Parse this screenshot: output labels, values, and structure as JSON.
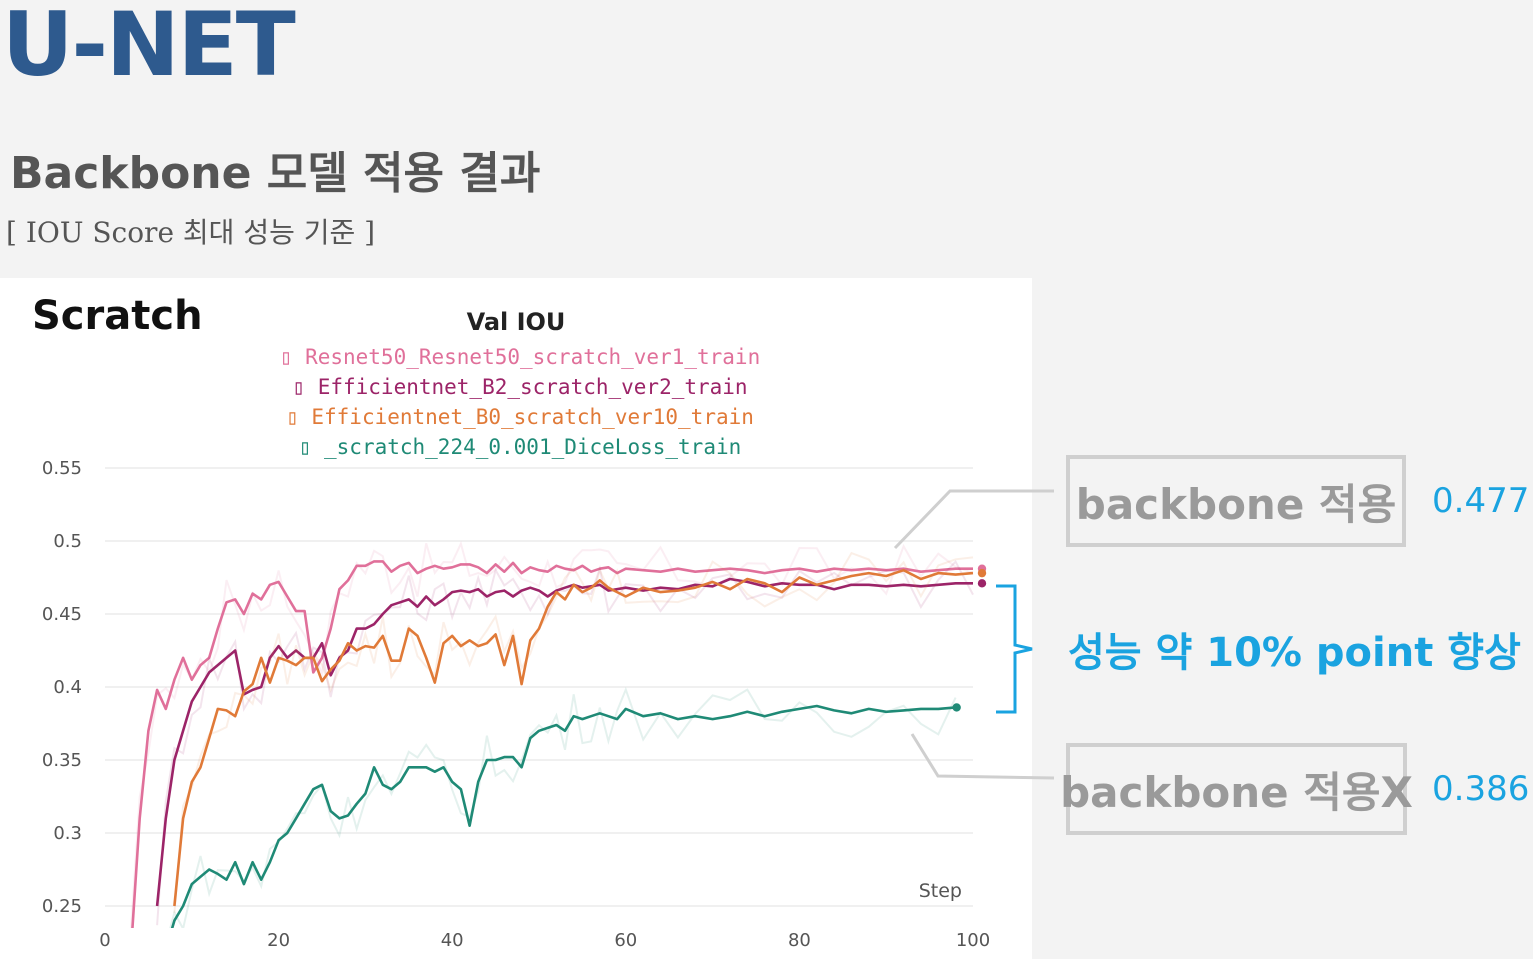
{
  "slide": {
    "title": "U-NET",
    "section_title": "Backbone 모델 적용 결과",
    "criteria": "[ IOU Score 최대 성능 기준 ]"
  },
  "panel": {
    "label": "Scratch"
  },
  "callouts": {
    "with_backbone": {
      "label": "backbone 적용",
      "value": "0.477"
    },
    "without_backbone": {
      "label": "backbone 적용X",
      "value": "0.386"
    },
    "improvement": "성능 약 10% point 향상",
    "colors": {
      "box_border": "#cfcfcf",
      "accent": "#1aa3e0"
    }
  },
  "chart_data": {
    "type": "line",
    "title": "Val IOU",
    "xlabel": "Step",
    "ylabel": "",
    "xlim": [
      0,
      100
    ],
    "ylim": [
      0.25,
      0.55
    ],
    "x_ticks": [
      "0",
      "20",
      "40",
      "60",
      "80",
      "100"
    ],
    "y_ticks": [
      "0.55",
      "0.5",
      "0.45",
      "0.4",
      "0.35",
      "0.3",
      "0.25"
    ],
    "grid": true,
    "legend_position": "top-center",
    "series": [
      {
        "name": "Resnet50_Resnet50_scratch_ver1_train",
        "color": "#e0709a",
        "final": 0.481,
        "points": [
          [
            3,
            0.22
          ],
          [
            4,
            0.31
          ],
          [
            5,
            0.37
          ],
          [
            6,
            0.398
          ],
          [
            7,
            0.385
          ],
          [
            8,
            0.405
          ],
          [
            9,
            0.42
          ],
          [
            10,
            0.405
          ],
          [
            11,
            0.415
          ],
          [
            12,
            0.42
          ],
          [
            13,
            0.44
          ],
          [
            14,
            0.458
          ],
          [
            15,
            0.46
          ],
          [
            16,
            0.45
          ],
          [
            17,
            0.464
          ],
          [
            18,
            0.46
          ],
          [
            19,
            0.47
          ],
          [
            20,
            0.472
          ],
          [
            21,
            0.462
          ],
          [
            22,
            0.452
          ],
          [
            23,
            0.452
          ],
          [
            24,
            0.41
          ],
          [
            25,
            0.42
          ],
          [
            26,
            0.44
          ],
          [
            27,
            0.467
          ],
          [
            28,
            0.473
          ],
          [
            29,
            0.483
          ],
          [
            30,
            0.483
          ],
          [
            31,
            0.486
          ],
          [
            32,
            0.486
          ],
          [
            33,
            0.479
          ],
          [
            34,
            0.483
          ],
          [
            35,
            0.485
          ],
          [
            36,
            0.478
          ],
          [
            37,
            0.481
          ],
          [
            38,
            0.483
          ],
          [
            39,
            0.481
          ],
          [
            40,
            0.482
          ],
          [
            41,
            0.484
          ],
          [
            42,
            0.484
          ],
          [
            43,
            0.482
          ],
          [
            44,
            0.478
          ],
          [
            45,
            0.484
          ],
          [
            46,
            0.479
          ],
          [
            47,
            0.485
          ],
          [
            48,
            0.478
          ],
          [
            49,
            0.482
          ],
          [
            50,
            0.48
          ],
          [
            51,
            0.479
          ],
          [
            52,
            0.483
          ],
          [
            53,
            0.481
          ],
          [
            54,
            0.48
          ],
          [
            55,
            0.483
          ],
          [
            56,
            0.479
          ],
          [
            57,
            0.481
          ],
          [
            58,
            0.482
          ],
          [
            59,
            0.478
          ],
          [
            60,
            0.481
          ],
          [
            62,
            0.48
          ],
          [
            64,
            0.479
          ],
          [
            66,
            0.481
          ],
          [
            68,
            0.479
          ],
          [
            70,
            0.48
          ],
          [
            72,
            0.481
          ],
          [
            74,
            0.48
          ],
          [
            76,
            0.478
          ],
          [
            78,
            0.48
          ],
          [
            80,
            0.481
          ],
          [
            82,
            0.479
          ],
          [
            84,
            0.481
          ],
          [
            86,
            0.48
          ],
          [
            88,
            0.481
          ],
          [
            90,
            0.48
          ],
          [
            92,
            0.481
          ],
          [
            94,
            0.479
          ],
          [
            96,
            0.48
          ],
          [
            98,
            0.481
          ],
          [
            100,
            0.481
          ]
        ]
      },
      {
        "name": "Efficientnet_B2_scratch_ver2_train",
        "color": "#9c2468",
        "final": 0.471,
        "points": [
          [
            6,
            0.25
          ],
          [
            7,
            0.31
          ],
          [
            8,
            0.35
          ],
          [
            9,
            0.37
          ],
          [
            10,
            0.39
          ],
          [
            11,
            0.4
          ],
          [
            12,
            0.41
          ],
          [
            13,
            0.415
          ],
          [
            14,
            0.42
          ],
          [
            15,
            0.425
          ],
          [
            16,
            0.395
          ],
          [
            17,
            0.398
          ],
          [
            18,
            0.4
          ],
          [
            19,
            0.42
          ],
          [
            20,
            0.428
          ],
          [
            21,
            0.42
          ],
          [
            22,
            0.425
          ],
          [
            23,
            0.42
          ],
          [
            24,
            0.42
          ],
          [
            25,
            0.43
          ],
          [
            26,
            0.408
          ],
          [
            27,
            0.42
          ],
          [
            28,
            0.425
          ],
          [
            29,
            0.44
          ],
          [
            30,
            0.44
          ],
          [
            31,
            0.443
          ],
          [
            32,
            0.45
          ],
          [
            33,
            0.456
          ],
          [
            34,
            0.458
          ],
          [
            35,
            0.46
          ],
          [
            36,
            0.455
          ],
          [
            37,
            0.462
          ],
          [
            38,
            0.456
          ],
          [
            39,
            0.46
          ],
          [
            40,
            0.465
          ],
          [
            41,
            0.466
          ],
          [
            42,
            0.465
          ],
          [
            43,
            0.467
          ],
          [
            44,
            0.462
          ],
          [
            45,
            0.465
          ],
          [
            46,
            0.466
          ],
          [
            47,
            0.462
          ],
          [
            48,
            0.466
          ],
          [
            49,
            0.468
          ],
          [
            50,
            0.466
          ],
          [
            51,
            0.462
          ],
          [
            52,
            0.466
          ],
          [
            53,
            0.468
          ],
          [
            54,
            0.47
          ],
          [
            55,
            0.468
          ],
          [
            56,
            0.469
          ],
          [
            57,
            0.47
          ],
          [
            58,
            0.466
          ],
          [
            60,
            0.468
          ],
          [
            62,
            0.466
          ],
          [
            64,
            0.468
          ],
          [
            66,
            0.467
          ],
          [
            68,
            0.47
          ],
          [
            70,
            0.469
          ],
          [
            72,
            0.474
          ],
          [
            74,
            0.472
          ],
          [
            76,
            0.469
          ],
          [
            78,
            0.471
          ],
          [
            80,
            0.47
          ],
          [
            82,
            0.47
          ],
          [
            84,
            0.467
          ],
          [
            86,
            0.47
          ],
          [
            88,
            0.47
          ],
          [
            90,
            0.469
          ],
          [
            92,
            0.47
          ],
          [
            94,
            0.469
          ],
          [
            96,
            0.47
          ],
          [
            98,
            0.471
          ],
          [
            100,
            0.471
          ]
        ]
      },
      {
        "name": "Efficientnet_B0_scratch_ver10_train",
        "color": "#e07a38",
        "final": 0.478,
        "points": [
          [
            8,
            0.25
          ],
          [
            9,
            0.31
          ],
          [
            10,
            0.335
          ],
          [
            11,
            0.345
          ],
          [
            12,
            0.365
          ],
          [
            13,
            0.385
          ],
          [
            14,
            0.384
          ],
          [
            15,
            0.38
          ],
          [
            16,
            0.397
          ],
          [
            17,
            0.402
          ],
          [
            18,
            0.42
          ],
          [
            19,
            0.403
          ],
          [
            20,
            0.42
          ],
          [
            21,
            0.418
          ],
          [
            22,
            0.415
          ],
          [
            23,
            0.42
          ],
          [
            24,
            0.42
          ],
          [
            25,
            0.404
          ],
          [
            26,
            0.412
          ],
          [
            27,
            0.418
          ],
          [
            28,
            0.43
          ],
          [
            29,
            0.425
          ],
          [
            30,
            0.428
          ],
          [
            31,
            0.427
          ],
          [
            32,
            0.435
          ],
          [
            33,
            0.418
          ],
          [
            34,
            0.418
          ],
          [
            35,
            0.44
          ],
          [
            36,
            0.435
          ],
          [
            37,
            0.42
          ],
          [
            38,
            0.403
          ],
          [
            39,
            0.43
          ],
          [
            40,
            0.435
          ],
          [
            41,
            0.428
          ],
          [
            42,
            0.432
          ],
          [
            43,
            0.428
          ],
          [
            44,
            0.43
          ],
          [
            45,
            0.436
          ],
          [
            46,
            0.415
          ],
          [
            47,
            0.435
          ],
          [
            48,
            0.402
          ],
          [
            49,
            0.432
          ],
          [
            50,
            0.44
          ],
          [
            51,
            0.455
          ],
          [
            52,
            0.465
          ],
          [
            53,
            0.46
          ],
          [
            54,
            0.47
          ],
          [
            55,
            0.465
          ],
          [
            56,
            0.468
          ],
          [
            57,
            0.473
          ],
          [
            58,
            0.468
          ],
          [
            59,
            0.465
          ],
          [
            60,
            0.462
          ],
          [
            62,
            0.468
          ],
          [
            64,
            0.465
          ],
          [
            66,
            0.466
          ],
          [
            68,
            0.468
          ],
          [
            70,
            0.472
          ],
          [
            72,
            0.467
          ],
          [
            74,
            0.474
          ],
          [
            76,
            0.471
          ],
          [
            78,
            0.465
          ],
          [
            80,
            0.475
          ],
          [
            82,
            0.47
          ],
          [
            84,
            0.473
          ],
          [
            86,
            0.476
          ],
          [
            88,
            0.478
          ],
          [
            90,
            0.476
          ],
          [
            92,
            0.48
          ],
          [
            94,
            0.474
          ],
          [
            96,
            0.478
          ],
          [
            98,
            0.477
          ],
          [
            100,
            0.478
          ]
        ]
      },
      {
        "name": "_scratch_224_0.001_DiceLoss_train",
        "color": "#1f8a76",
        "final": 0.386,
        "points": [
          [
            7,
            0.22
          ],
          [
            8,
            0.24
          ],
          [
            9,
            0.25
          ],
          [
            10,
            0.265
          ],
          [
            11,
            0.27
          ],
          [
            12,
            0.275
          ],
          [
            13,
            0.272
          ],
          [
            14,
            0.268
          ],
          [
            15,
            0.28
          ],
          [
            16,
            0.265
          ],
          [
            17,
            0.28
          ],
          [
            18,
            0.268
          ],
          [
            19,
            0.28
          ],
          [
            20,
            0.295
          ],
          [
            21,
            0.3
          ],
          [
            22,
            0.31
          ],
          [
            23,
            0.32
          ],
          [
            24,
            0.33
          ],
          [
            25,
            0.333
          ],
          [
            26,
            0.315
          ],
          [
            27,
            0.31
          ],
          [
            28,
            0.312
          ],
          [
            29,
            0.32
          ],
          [
            30,
            0.327
          ],
          [
            31,
            0.345
          ],
          [
            32,
            0.333
          ],
          [
            33,
            0.33
          ],
          [
            34,
            0.335
          ],
          [
            35,
            0.345
          ],
          [
            36,
            0.345
          ],
          [
            37,
            0.345
          ],
          [
            38,
            0.342
          ],
          [
            39,
            0.345
          ],
          [
            40,
            0.335
          ],
          [
            41,
            0.33
          ],
          [
            42,
            0.305
          ],
          [
            43,
            0.335
          ],
          [
            44,
            0.35
          ],
          [
            45,
            0.35
          ],
          [
            46,
            0.352
          ],
          [
            47,
            0.352
          ],
          [
            48,
            0.345
          ],
          [
            49,
            0.365
          ],
          [
            50,
            0.37
          ],
          [
            51,
            0.372
          ],
          [
            52,
            0.374
          ],
          [
            53,
            0.37
          ],
          [
            54,
            0.38
          ],
          [
            55,
            0.378
          ],
          [
            56,
            0.38
          ],
          [
            57,
            0.382
          ],
          [
            58,
            0.38
          ],
          [
            59,
            0.378
          ],
          [
            60,
            0.385
          ],
          [
            62,
            0.38
          ],
          [
            64,
            0.382
          ],
          [
            66,
            0.378
          ],
          [
            68,
            0.38
          ],
          [
            70,
            0.378
          ],
          [
            72,
            0.38
          ],
          [
            74,
            0.383
          ],
          [
            76,
            0.38
          ],
          [
            78,
            0.383
          ],
          [
            80,
            0.385
          ],
          [
            82,
            0.387
          ],
          [
            84,
            0.384
          ],
          [
            86,
            0.382
          ],
          [
            88,
            0.385
          ],
          [
            90,
            0.383
          ],
          [
            92,
            0.384
          ],
          [
            94,
            0.385
          ],
          [
            96,
            0.385
          ],
          [
            98,
            0.386
          ]
        ]
      }
    ]
  }
}
